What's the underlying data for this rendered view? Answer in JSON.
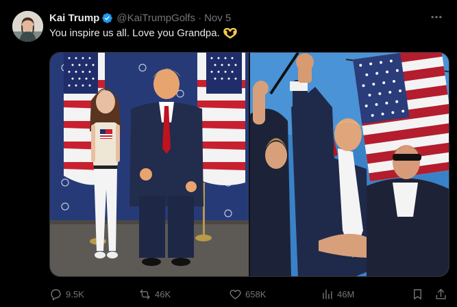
{
  "tweet": {
    "display_name": "Kai Trump",
    "handle": "@KaiTrumpGolfs",
    "separator": "·",
    "date": "Nov 5",
    "text": "You inspire us all. Love you Grandpa.",
    "emoji": "heart-hands-emoji"
  },
  "actions": {
    "replies": "9.5K",
    "reposts": "46K",
    "likes": "658K",
    "views": "46M"
  },
  "icons": {
    "verified": "verified-badge-icon",
    "more": "more-dots-icon",
    "reply": "reply-icon",
    "repost": "repost-icon",
    "like": "heart-icon",
    "views": "views-chart-icon",
    "bookmark": "bookmark-icon",
    "share": "share-icon"
  },
  "colors": {
    "background": "#000000",
    "text": "#e7e9ea",
    "muted": "#71767b",
    "verified_blue": "#1d9bf0",
    "border": "#2f3336"
  }
}
